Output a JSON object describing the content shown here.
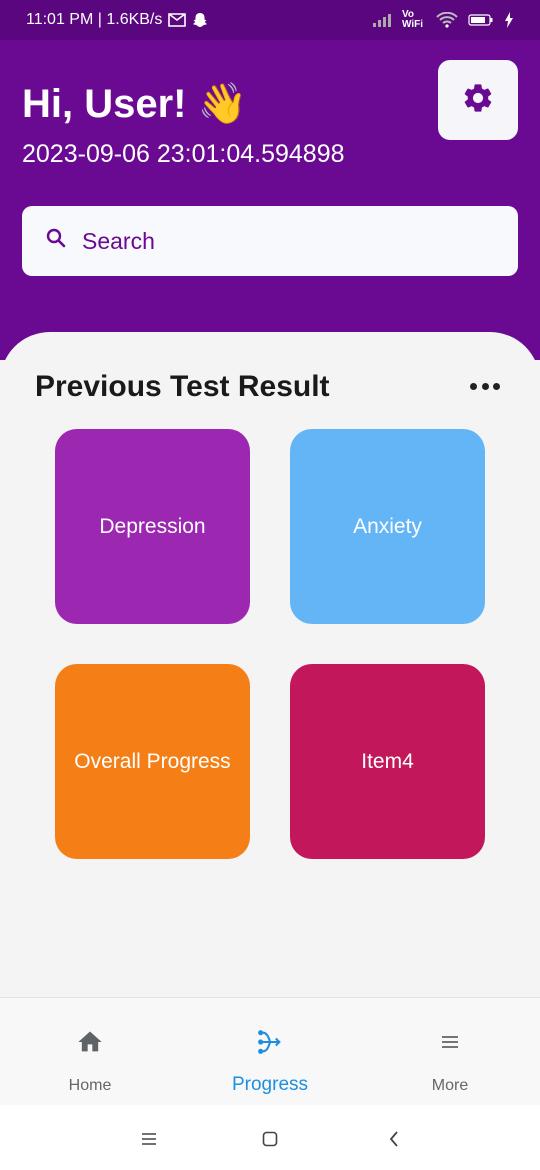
{
  "status_bar": {
    "time_text": "11:01 PM | 1.6KB/s",
    "network_label": "Vo WiFi",
    "battery_level": "78"
  },
  "header": {
    "greeting": "Hi, User! 👋",
    "timestamp": "2023-09-06 23:01:04.594898",
    "settings_icon": "gear-icon"
  },
  "search": {
    "placeholder": "Search",
    "icon": "search-icon"
  },
  "main": {
    "section_title": "Previous Test Result",
    "more_icon": "more-horizontal-icon",
    "tiles": [
      {
        "label": "Depression",
        "color": "#9c27b0"
      },
      {
        "label": "Anxiety",
        "color": "#64b5f6"
      },
      {
        "label": "Overall Progress",
        "color": "#f57f17"
      },
      {
        "label": "Item4",
        "color": "#c2185b"
      }
    ]
  },
  "bottom_nav": {
    "items": [
      {
        "label": "Home",
        "icon": "home-icon",
        "active": false
      },
      {
        "label": "Progress",
        "icon": "progress-icon",
        "active": true
      },
      {
        "label": "More",
        "icon": "menu-icon",
        "active": false
      }
    ]
  },
  "colors": {
    "header_bg": "#6a0a93",
    "status_bg": "#5a067e",
    "accent": "#1e8fe0"
  }
}
